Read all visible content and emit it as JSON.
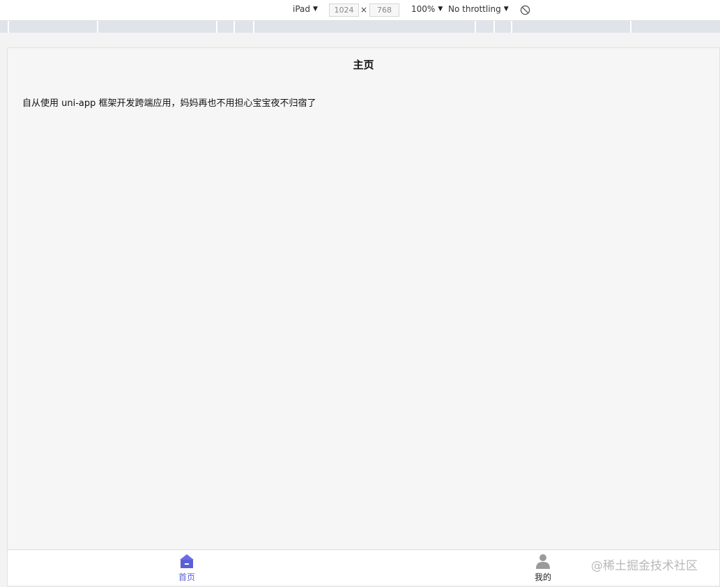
{
  "devtools": {
    "device": "iPad",
    "width": "1024",
    "separator": "×",
    "height": "768",
    "zoom": "100%",
    "throttling": "No throttling",
    "arrow": "▼"
  },
  "app": {
    "nav_title": "主页",
    "content_text": "自从使用 uni-app 框架开发跨端应用，妈妈再也不用担心宝宝夜不归宿了",
    "tabs": [
      {
        "label": "首页",
        "icon": "home-icon",
        "active": true,
        "color": "#5b5fd6"
      },
      {
        "label": "我的",
        "icon": "user-icon",
        "active": false,
        "color": "#222222"
      }
    ]
  },
  "watermark": "@稀土掘金技术社区"
}
